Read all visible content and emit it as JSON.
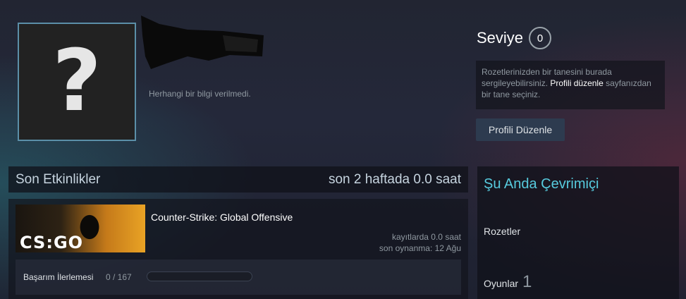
{
  "profile": {
    "summary": "Herhangi bir bilgi verilmedi.",
    "avatar_glyph": "?"
  },
  "level": {
    "label": "Seviye",
    "value": "0"
  },
  "badge_showcase": {
    "text_before": "Rozetlerinizden bir tanesini burada sergileyebilirsiniz. ",
    "link": "Profili düzenle",
    "text_after": " sayfanızdan bir tane seçiniz."
  },
  "edit_profile_button": "Profili Düzenle",
  "recent_activity": {
    "title": "Son Etkinlikler",
    "hours": "son 2 haftada 0.0 saat",
    "games": [
      {
        "name": "Counter-Strike: Global Offensive",
        "logo_text": "CS:GO",
        "hours_on_record": "kayıtlarda 0.0 saat",
        "last_played": "son oynanma: 12 Ağu",
        "achievements_label": "Başarım İlerlemesi",
        "achievements_count": "0 / 167",
        "achievements_progress": 0
      }
    ]
  },
  "side": {
    "status": "Şu Anda Çevrimiçi",
    "badges_label": "Rozetler",
    "games_label": "Oyunlar",
    "games_count": "1"
  },
  "colors": {
    "accent_online": "#57cbde",
    "button_bg": "#2d3b4f",
    "progress_fill": "#5f96c4"
  }
}
